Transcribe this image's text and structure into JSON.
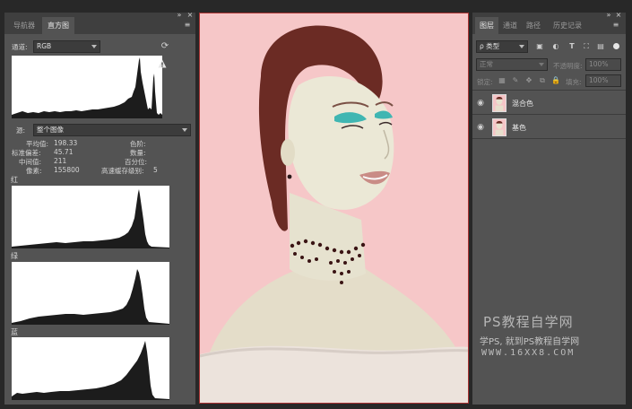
{
  "histogram_panel": {
    "tabs": [
      "导航器",
      "直方图"
    ],
    "channel_label": "通道:",
    "channel_value": "RGB",
    "source_label": "源:",
    "source_value": "整个图像",
    "stats": {
      "mean_label": "平均值:",
      "mean_value": "198.33",
      "stddev_label": "标准偏差:",
      "stddev_value": "45.71",
      "median_label": "中间值:",
      "median_value": "211",
      "pixels_label": "像素:",
      "pixels_value": "155800",
      "level_label": "色阶:",
      "count_label": "数量:",
      "percentile_label": "百分位:",
      "cache_label": "高速缓存级别:",
      "cache_value": "5"
    },
    "channels": [
      "红",
      "绿",
      "蓝"
    ]
  },
  "layers_panel": {
    "tabs": [
      "图层",
      "通道",
      "路径",
      "历史记录"
    ],
    "kind_filter": "ρ 类型",
    "blend_mode": "正常",
    "opacity_label": "不透明度:",
    "opacity_value": "100%",
    "lock_label": "锁定:",
    "fill_label": "填充:",
    "fill_value": "100%",
    "layers": [
      {
        "name": "混合色"
      },
      {
        "name": "基色"
      }
    ]
  },
  "watermark": {
    "line1": "PS教程自学网",
    "line2": "学PS, 就到PS教程自学网",
    "line3": "WWW.16XX8.COM"
  },
  "colors": {
    "canvas_bg": "#f5c5c7",
    "panel_bg": "#535353",
    "tabbar_bg": "#3f3f3f",
    "eyeshadow": "#3fb6b2",
    "hair": "#6a2a22"
  }
}
